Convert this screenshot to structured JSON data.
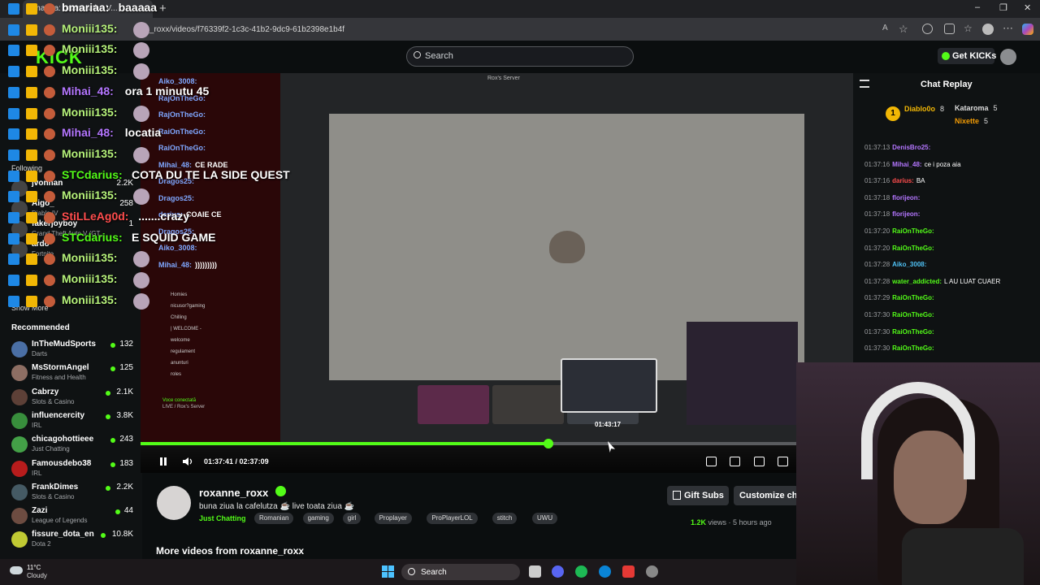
{
  "browser": {
    "tab_title": "bmariaa: baaaaa the V...",
    "url": "...e_roxx/videos/f76339f2-1c3c-41b2-9dc9-61b2398e1b4f"
  },
  "header": {
    "search_placeholder": "Search",
    "get_kicks_label": "Get KICKs",
    "logo_text": "KICK"
  },
  "sidebar": {
    "following_label": "Following",
    "show_more_label": "Show More",
    "recommended_heading": "Recommended",
    "following_items": [
      {
        "name": "jvonhan",
        "category": "",
        "count": "2.2K"
      },
      {
        "name": "Aigo_",
        "category": "Diablo IV",
        "count": "258"
      },
      {
        "name": "fakerjoyboy",
        "category": "Grand Theft Auto V (GT...",
        "count": "1"
      },
      {
        "name": "ardo",
        "category": "Fortnite",
        "count": ""
      }
    ],
    "recommended": [
      {
        "name": "InTheMudSports",
        "category": "Darts",
        "count": "132",
        "color": "#4a6fa5"
      },
      {
        "name": "MsStormAngel",
        "category": "Fitness and Health",
        "count": "125",
        "color": "#8d6e63"
      },
      {
        "name": "Cabrzy",
        "category": "Slots & Casino",
        "count": "2.1K",
        "color": "#5d4037"
      },
      {
        "name": "influencercity",
        "category": "IRL",
        "count": "3.8K",
        "color": "#388e3c"
      },
      {
        "name": "chicagohottieee",
        "category": "Just Chatting",
        "count": "243",
        "color": "#43a047"
      },
      {
        "name": "Famousdebo38",
        "category": "IRL",
        "count": "183",
        "color": "#b71c1c"
      },
      {
        "name": "FrankDimes",
        "category": "Slots & Casino",
        "count": "2.2K",
        "color": "#455a64"
      },
      {
        "name": "Zazi",
        "category": "League of Legends",
        "count": "44",
        "color": "#6d4c41"
      },
      {
        "name": "fissure_dota_en",
        "category": "Dota 2",
        "count": "10.8K",
        "color": "#c0ca33"
      }
    ]
  },
  "overlay_chat": [
    {
      "user": "bmariaa:",
      "msg": "baaaaa",
      "color": "#fff"
    },
    {
      "user": "Moniii135:",
      "msg": "",
      "color": "#b6f27a"
    },
    {
      "user": "Moniii135:",
      "msg": "",
      "color": "#b6f27a"
    },
    {
      "user": "Moniii135:",
      "msg": "",
      "color": "#b6f27a"
    },
    {
      "user": "Mihai_48:",
      "msg": "ora 1 minutu 45",
      "color": "#b476ff"
    },
    {
      "user": "Moniii135:",
      "msg": "",
      "color": "#b6f27a"
    },
    {
      "user": "Mihai_48:",
      "msg": "locatia",
      "color": "#b476ff"
    },
    {
      "user": "Moniii135:",
      "msg": "",
      "color": "#b6f27a"
    },
    {
      "user": "STCdarius:",
      "msg": "COTA DU TE LA SIDE QUEST",
      "color": "#53fc18"
    },
    {
      "user": "Moniii135:",
      "msg": "",
      "color": "#b6f27a"
    },
    {
      "user": "StiLLeAg0d:",
      "msg": ".......crazy",
      "color": "#ff4d4d"
    },
    {
      "user": "STCdarius:",
      "msg": "E SQUID GAME",
      "color": "#53fc18"
    },
    {
      "user": "Moniii135:",
      "msg": "",
      "color": "#b6f27a"
    },
    {
      "user": "Moniii135:",
      "msg": "",
      "color": "#b6f27a"
    },
    {
      "user": "Moniii135:",
      "msg": "",
      "color": "#b6f27a"
    }
  ],
  "video": {
    "discord_title": "Rox's Server",
    "current_time": "01:37:41",
    "duration": "02:37:09",
    "progress": 0.6216,
    "preview_time": "01:43:17",
    "preview_progress": 0.7195,
    "discord_messages": [
      {
        "user": "Aiko_3008:",
        "msg": ""
      },
      {
        "user": "RajOnTheGo:",
        "msg": ""
      },
      {
        "user": "RajOnTheGo:",
        "msg": ""
      },
      {
        "user": "RaiOnTheGo:",
        "msg": ""
      },
      {
        "user": "RaiOnTheGo:",
        "msg": ""
      },
      {
        "user": "Mihai_48:",
        "msg": "CE RADE"
      },
      {
        "user": "Dragos25:",
        "msg": ""
      },
      {
        "user": "Dragos25:",
        "msg": ""
      },
      {
        "user": "darius:",
        "msg": "COAIE CE"
      },
      {
        "user": "Dragos25:",
        "msg": ""
      },
      {
        "user": "Aiko_3008:",
        "msg": ""
      },
      {
        "user": "Mihai_48:",
        "msg": ")))))))))"
      }
    ],
    "discord_channels": [
      "Homies",
      "nicusor?gaming",
      "Chilling",
      "| WELCOME -",
      "welcome",
      "regulament",
      "anunturi",
      "roles"
    ],
    "discord_status": "Voce conectată",
    "discord_server": "LIVE / Rox's Server"
  },
  "channel": {
    "name": "roxanne_roxx",
    "title": "buna ziua la cafelutza",
    "title2": "live toata ziua",
    "category": "Just Chatting",
    "tags": [
      "Romanian",
      "gaming",
      "girl",
      "Proplayer",
      "ProPlayerLOL",
      "stitch",
      "UWU"
    ],
    "views": "1.2K",
    "views_label": "views",
    "age": "5 hours ago",
    "gift_label": "Gift Subs",
    "customize_label": "Customize ch",
    "more_videos": "More videos from roxanne_roxx"
  },
  "chat_replay": {
    "title": "Chat Replay",
    "leaders": [
      {
        "name": "Diablo0o",
        "count": "8",
        "color": "#f2b705"
      },
      {
        "name": "Kataroma",
        "count": "5",
        "color": "#ddd"
      },
      {
        "name": "Nixette",
        "count": "5",
        "color": "#f29b05"
      }
    ],
    "leader_rank": "1",
    "messages": [
      {
        "time": "01:37:13",
        "user": "DenisBro25:",
        "msg": "",
        "color": "#b476ff"
      },
      {
        "time": "01:37:16",
        "user": "Mihai_48:",
        "msg": "ce i poza aia",
        "color": "#b476ff"
      },
      {
        "time": "01:37:16",
        "user": "darius:",
        "msg": "BA",
        "color": "#ff4d4d"
      },
      {
        "time": "01:37:18",
        "user": "florijeon:",
        "msg": "",
        "color": "#b476ff"
      },
      {
        "time": "01:37:18",
        "user": "florijeon:",
        "msg": "",
        "color": "#b476ff"
      },
      {
        "time": "01:37:20",
        "user": "RaiOnTheGo:",
        "msg": "",
        "color": "#53fc18"
      },
      {
        "time": "01:37:20",
        "user": "RaiOnTheGo:",
        "msg": "",
        "color": "#53fc18"
      },
      {
        "time": "01:37:28",
        "user": "Aiko_3008:",
        "msg": "",
        "color": "#4fc3f7"
      },
      {
        "time": "01:37:28",
        "user": "water_addicted:",
        "msg": "L AU LUAT CUAER",
        "color": "#53fc18"
      },
      {
        "time": "01:37:29",
        "user": "RaiOnTheGo:",
        "msg": "",
        "color": "#53fc18"
      },
      {
        "time": "01:37:30",
        "user": "RaiOnTheGo:",
        "msg": "",
        "color": "#53fc18"
      },
      {
        "time": "01:37:30",
        "user": "RaiOnTheGo:",
        "msg": "",
        "color": "#53fc18"
      },
      {
        "time": "01:37:30",
        "user": "RaiOnTheGo:",
        "msg": "",
        "color": "#53fc18"
      }
    ]
  },
  "taskbar": {
    "temp": "11°C",
    "condition": "Cloudy",
    "search_label": "Search"
  },
  "colors": {
    "accent": "#53fc18",
    "background": "#0b0e0f"
  }
}
